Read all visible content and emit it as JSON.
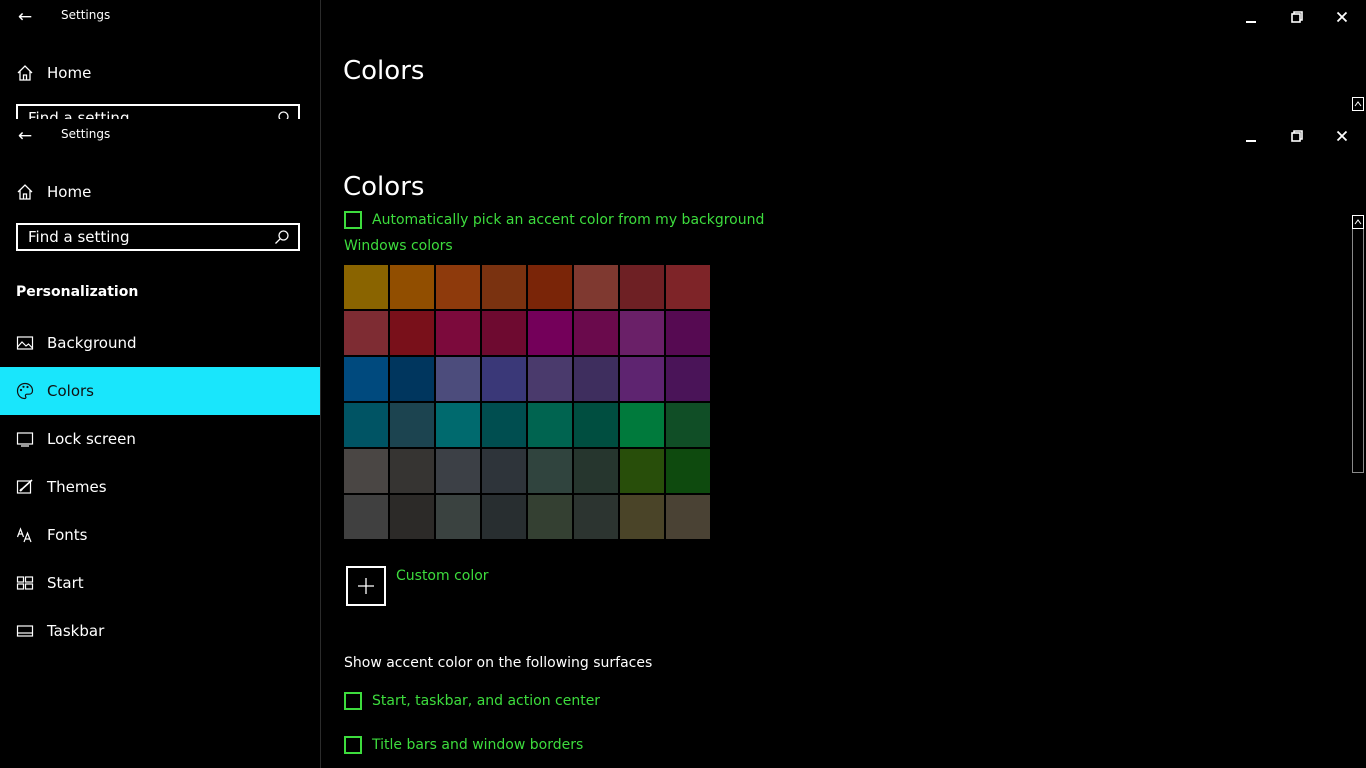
{
  "colors": {
    "accent_text": "#3ddc3d",
    "selected_nav_bg": "#19e6fc",
    "background": "#000000"
  },
  "window_back": {
    "app_title": "Settings",
    "home_label": "Home",
    "search_placeholder": "Find a setting",
    "page_title": "Colors"
  },
  "window_front": {
    "app_title": "Settings",
    "home_label": "Home",
    "search_placeholder": "Find a setting",
    "section_label": "Personalization",
    "nav": [
      {
        "label": "Background",
        "icon": "picture-icon"
      },
      {
        "label": "Colors",
        "icon": "palette-icon",
        "selected": true
      },
      {
        "label": "Lock screen",
        "icon": "lock-screen-icon"
      },
      {
        "label": "Themes",
        "icon": "themes-icon"
      },
      {
        "label": "Fonts",
        "icon": "fonts-icon"
      },
      {
        "label": "Start",
        "icon": "start-icon"
      },
      {
        "label": "Taskbar",
        "icon": "taskbar-icon"
      }
    ],
    "page_title": "Colors",
    "auto_accent_label": "Automatically pick an accent color from my background",
    "windows_colors_label": "Windows colors",
    "swatches": [
      "#8a6400",
      "#914e00",
      "#8e3a0c",
      "#7a3210",
      "#7a2508",
      "#7f3930",
      "#6e2024",
      "#7e2428",
      "#7e2c33",
      "#79101a",
      "#7c0a3c",
      "#6e0a30",
      "#74005a",
      "#6a0a4c",
      "#6a2068",
      "#560a52",
      "#004a7e",
      "#00365e",
      "#4c4c7c",
      "#3a3878",
      "#4a3a6c",
      "#3e2e5e",
      "#5e2470",
      "#4a1458",
      "#005464",
      "#1c4450",
      "#006a6e",
      "#004e50",
      "#006450",
      "#004e40",
      "#007a3c",
      "#104e26",
      "#4a4644",
      "#363432",
      "#3c4046",
      "#2e343a",
      "#30443e",
      "#26362e",
      "#284e0a",
      "#0e4a0e",
      "#404040",
      "#2c2a28",
      "#3a4240",
      "#282e30",
      "#344032",
      "#2c3430",
      "#4a4428",
      "#4a4234"
    ],
    "custom_color_label": "Custom color",
    "surfaces_label": "Show accent color on the following surfaces",
    "surface_options": [
      {
        "label": "Start, taskbar, and action center",
        "checked": false
      },
      {
        "label": "Title bars and window borders",
        "checked": false
      }
    ]
  }
}
